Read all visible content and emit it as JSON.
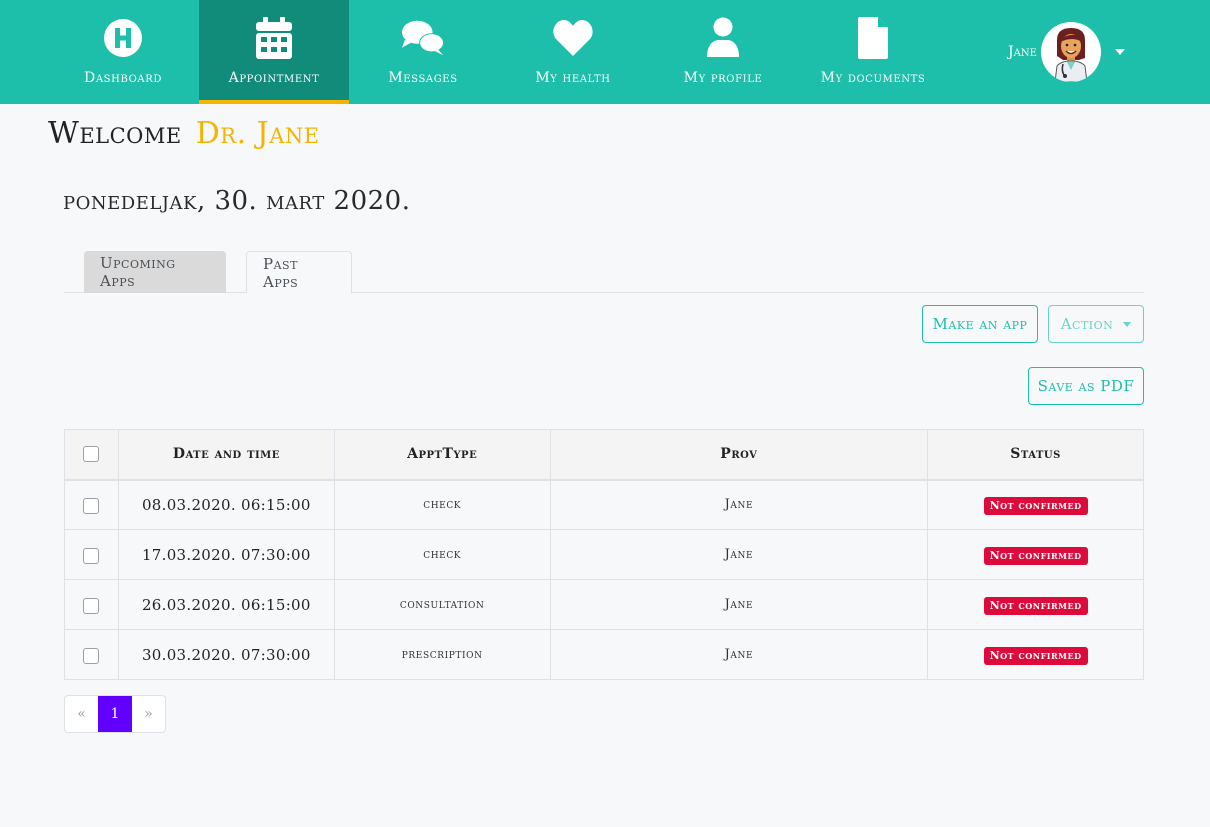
{
  "nav": {
    "items": [
      {
        "label": "Dashboard",
        "icon": "hospital-icon",
        "active": false
      },
      {
        "label": "Appointment",
        "icon": "calendar-icon",
        "active": true
      },
      {
        "label": "Messages",
        "icon": "chat-bubbles-icon",
        "active": false
      },
      {
        "label": "My health",
        "icon": "heart-icon",
        "active": false
      },
      {
        "label": "My profile",
        "icon": "user-icon",
        "active": false
      },
      {
        "label": "My documents",
        "icon": "document-icon",
        "active": false
      }
    ],
    "user": {
      "name": "Jane",
      "avatar": "doctor-avatar"
    }
  },
  "colors": {
    "navbar": "#1dbfaa",
    "navbar_active": "#118c7b",
    "active_underline": "#f4b400",
    "accent": "#1dbfaa",
    "badge_danger": "#dc0b3c",
    "pagination_active": "#6200ff"
  },
  "header": {
    "welcome": "Welcome",
    "doctor": "Dr. Jane",
    "date": "ponedeljak, 30. mart 2020."
  },
  "tabs": [
    {
      "label": "Upcoming Apps",
      "active": false
    },
    {
      "label": "Past Apps",
      "active": true
    }
  ],
  "toolbar": {
    "make_app": "Make an app",
    "action": "Action",
    "save_pdf": "Save as PDF"
  },
  "table": {
    "columns": [
      "Date and time",
      "ApptType",
      "Prov",
      "Status"
    ],
    "rows": [
      {
        "datetime": "08.03.2020. 06:15:00",
        "type": "check",
        "prov": "Jane",
        "status": "Not confirmed"
      },
      {
        "datetime": "17.03.2020. 07:30:00",
        "type": "check",
        "prov": "Jane",
        "status": "Not confirmed"
      },
      {
        "datetime": "26.03.2020. 06:15:00",
        "type": "consultation",
        "prov": "Jane",
        "status": "Not confirmed"
      },
      {
        "datetime": "30.03.2020. 07:30:00",
        "type": "prescription",
        "prov": "Jane",
        "status": "Not confirmed"
      }
    ]
  },
  "pagination": {
    "prev": "«",
    "current": "1",
    "next": "»"
  }
}
